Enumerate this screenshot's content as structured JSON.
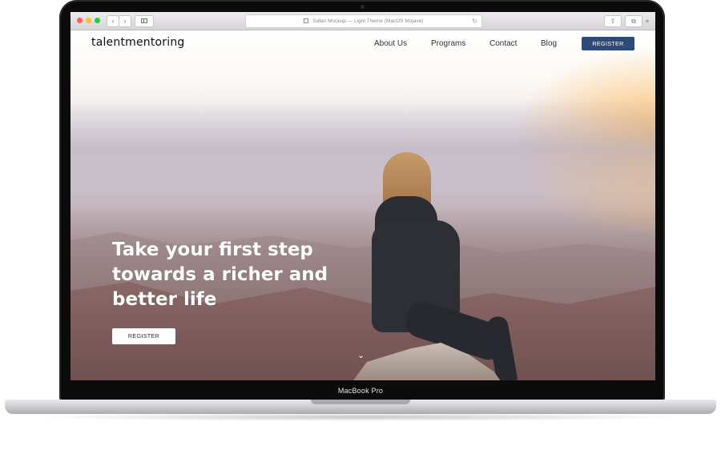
{
  "device": {
    "model_label": "MacBook Pro"
  },
  "browser": {
    "address_bar_text": "Safari Mockup — Light Theme (MacOS Mojave)",
    "icons": {
      "back": "chevron-left-icon",
      "forward": "chevron-right-icon",
      "sidebar": "sidebar-icon",
      "lock": "lock-icon",
      "reload": "reload-icon",
      "share": "share-icon",
      "tabs": "tabs-icon",
      "new_tab": "plus-icon"
    }
  },
  "site": {
    "logo_text": "talentmentoring",
    "nav": {
      "items": [
        {
          "label": "About Us"
        },
        {
          "label": "Programs"
        },
        {
          "label": "Contact"
        },
        {
          "label": "Blog"
        }
      ],
      "register_label": "REGISTER",
      "register_color": "#2d4a78"
    },
    "hero": {
      "title_lines": [
        "Take your first step",
        "towards a richer and",
        "better life"
      ],
      "cta_label": "REGISTER",
      "scroll_icon": "chevron-down-icon"
    }
  }
}
